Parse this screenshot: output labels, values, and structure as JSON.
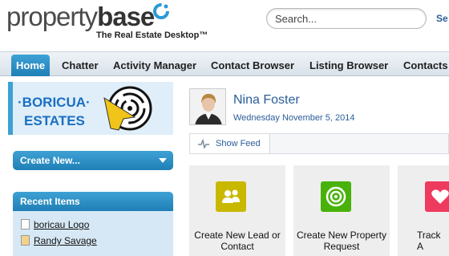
{
  "header": {
    "brand_light": "property",
    "brand_bold": "base",
    "tagline": "The Real Estate Desktop™",
    "search_placeholder": "Search...",
    "search_button": "Se"
  },
  "tabs": [
    {
      "label": "Home",
      "active": true
    },
    {
      "label": "Chatter"
    },
    {
      "label": "Activity Manager"
    },
    {
      "label": "Contact Browser"
    },
    {
      "label": "Listing Browser"
    },
    {
      "label": "Contacts"
    }
  ],
  "sidebar": {
    "brand_line1": "·BORICUA·",
    "brand_line2": "ESTATES",
    "create_new": "Create New...",
    "recent_header": "Recent Items",
    "recent_items": [
      {
        "label": "boricau Logo",
        "icon": "document-icon"
      },
      {
        "label": "Randy Savage",
        "icon": "contact-icon"
      }
    ]
  },
  "profile": {
    "name": "Nina Foster",
    "date": "Wednesday November 5, 2014"
  },
  "feed": {
    "show_feed": "Show Feed"
  },
  "tiles": [
    {
      "label_line1": "Create New Lead or",
      "label_line2": "Contact",
      "color": "#c9b800",
      "icon": "people-icon"
    },
    {
      "label_line1": "Create New Property",
      "label_line2": "Request",
      "color": "#49b20a",
      "icon": "target-icon"
    },
    {
      "label_line1": "Track A",
      "label_line2": "",
      "color": "#ee3a5e",
      "icon": "heart-icon"
    }
  ],
  "colors": {
    "accent": "#1f7fb6",
    "link": "#2a5d99"
  }
}
